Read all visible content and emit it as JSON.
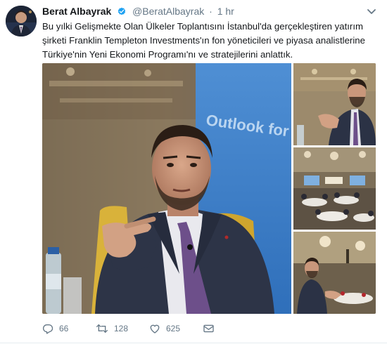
{
  "tweet": {
    "name": "Berat Albayrak",
    "handle": "@BeratAlbayrak",
    "separator": "·",
    "time": "1 hr",
    "text": "Bu yılki Gelişmekte Olan Ülkeler Toplantısını İstanbul'da gerçekleştiren yatırım\nşirketi Franklin Templeton Investments'ın fon yöneticileri ve piyasa analistlerine\nTürkiye'nin Yeni Ekonomi Programı'nı ve stratejilerini anlattık.",
    "slide_text": "Outlook for T"
  },
  "actions": {
    "replies": "66",
    "retweets": "128",
    "likes": "625"
  },
  "colors": {
    "accent": "#1da1f2",
    "muted": "#657786",
    "text": "#14171a"
  },
  "icons": [
    "avatar",
    "verified-icon",
    "chevron-down-icon",
    "reply-icon",
    "retweet-icon",
    "like-icon",
    "message-icon"
  ]
}
